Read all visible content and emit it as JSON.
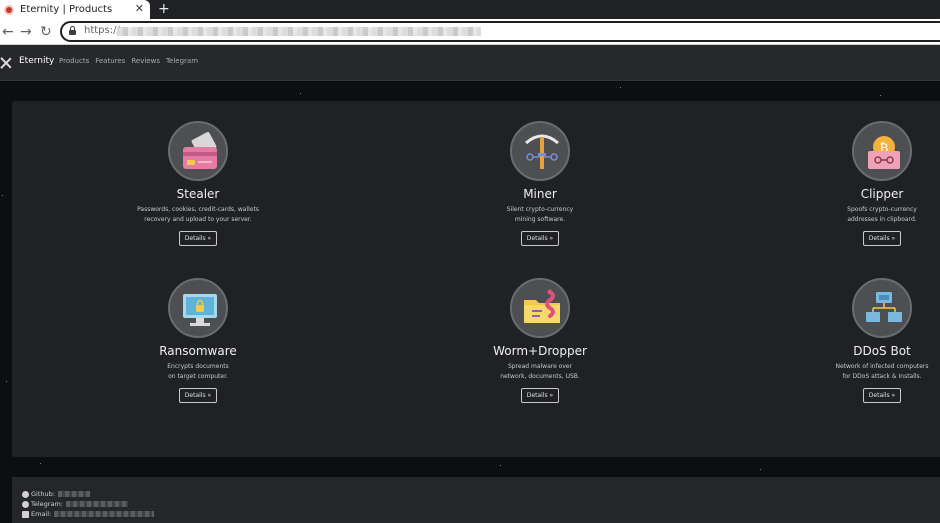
{
  "browser": {
    "tab_title": "Eternity | Products",
    "tab_close": "✕",
    "new_tab": "+",
    "back": "←",
    "forward": "→",
    "reload": "↻",
    "url": "https://"
  },
  "navbar": {
    "brand": "Eternity",
    "links": [
      "Products",
      "Features",
      "Reviews",
      "Telegram"
    ]
  },
  "products": [
    {
      "name": "Stealer",
      "desc_line1": "Passwords, cookies, credit-cards, wallets",
      "desc_line2": "recovery and upload to your server.",
      "button": "Details »",
      "icon": "credit-card-icon"
    },
    {
      "name": "Miner",
      "desc_line1": "Silent crypto-currency",
      "desc_line2": "mining software.",
      "button": "Details »",
      "icon": "pickaxe-icon"
    },
    {
      "name": "Clipper",
      "desc_line1": "Spoofs crypto-currency",
      "desc_line2": "addresses in clipboard.",
      "button": "Details »",
      "icon": "bitcoin-chip-icon"
    },
    {
      "name": "Ransomware",
      "desc_line1": "Encrypts documents",
      "desc_line2": "on target computer.",
      "button": "Details »",
      "icon": "locked-monitor-icon"
    },
    {
      "name": "Worm+Dropper",
      "desc_line1": "Spread malware over",
      "desc_line2": "network, documents, USB.",
      "button": "Details »",
      "icon": "worm-folder-icon"
    },
    {
      "name": "DDoS Bot",
      "desc_line1": "Network of infected computers",
      "desc_line2": "for DDoS attack & Installs.",
      "button": "Details »",
      "icon": "network-computers-icon"
    }
  ],
  "footer": {
    "github_label": "Github:",
    "telegram_label": "Telegram:",
    "email_label": "Email:"
  },
  "colors": {
    "page_bg": "#0d0e10",
    "panel_bg": "#1f2125",
    "navbar_bg": "#26282c",
    "footer_bg": "#24262a"
  }
}
